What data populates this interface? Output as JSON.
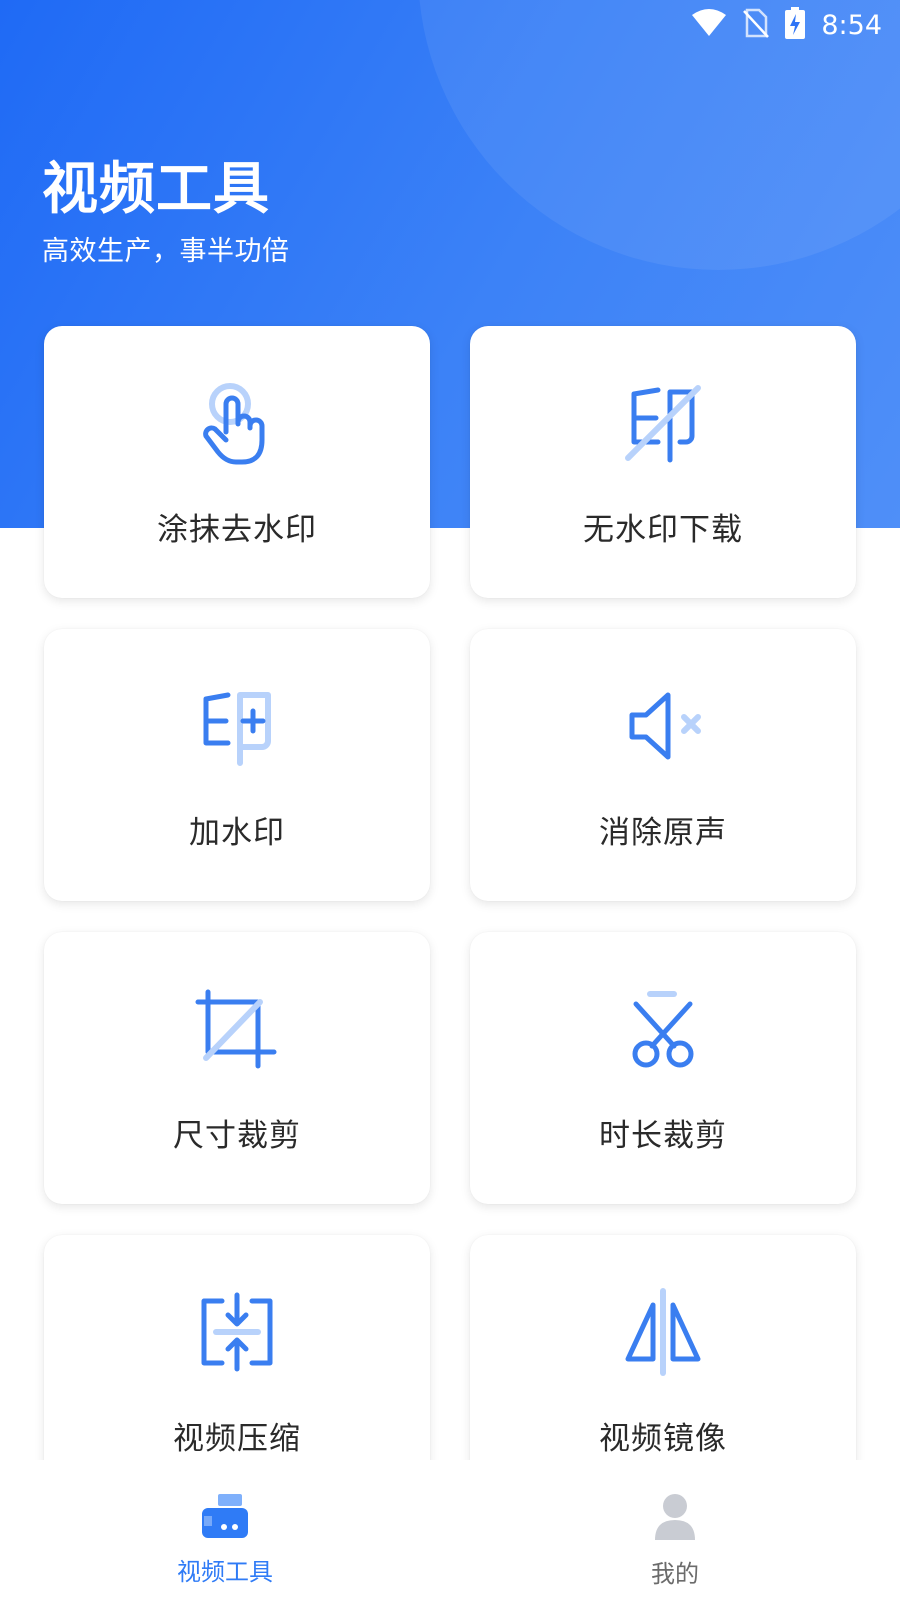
{
  "status_bar": {
    "time": "8:54"
  },
  "header": {
    "title": "视频工具",
    "subtitle": "高效生产，事半功倍"
  },
  "tools": [
    {
      "label": "涂抹去水印",
      "icon": "hand-pointer-icon"
    },
    {
      "label": "无水印下载",
      "icon": "watermark-off-icon"
    },
    {
      "label": "加水印",
      "icon": "watermark-add-icon"
    },
    {
      "label": "消除原声",
      "icon": "speaker-mute-icon"
    },
    {
      "label": "尺寸裁剪",
      "icon": "crop-icon"
    },
    {
      "label": "时长裁剪",
      "icon": "scissors-icon"
    },
    {
      "label": "视频压缩",
      "icon": "compress-icon"
    },
    {
      "label": "视频镜像",
      "icon": "mirror-icon"
    }
  ],
  "bottom_nav": {
    "items": [
      {
        "label": "视频工具",
        "icon": "video-tools-icon",
        "active": true
      },
      {
        "label": "我的",
        "icon": "profile-icon",
        "active": false
      }
    ]
  },
  "colors": {
    "accent": "#2f7bf6",
    "icon_dark": "#3a7ef0",
    "icon_light": "#b8d2fb",
    "inactive": "#c9ccd3"
  }
}
